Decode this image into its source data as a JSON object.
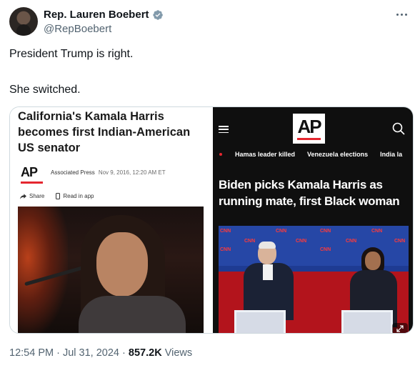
{
  "author": {
    "display_name": "Rep. Lauren Boebert",
    "handle": "@RepBoebert",
    "verified_color": "#829aab"
  },
  "tweet": {
    "line1": "President Trump is right.",
    "line2": "She switched."
  },
  "left_article": {
    "headline": "California's Kamala Harris becomes first Indian-American US senator",
    "logo": "AP",
    "source": "Associated Press",
    "date": "Nov 9, 2016, 12:20 AM ET",
    "share_label": "Share",
    "read_label": "Read in app",
    "accent": "#e5262f"
  },
  "right_article": {
    "logo": "AP",
    "nav_items": [
      "Hamas leader killed",
      "Venezuela elections",
      "India la"
    ],
    "headline": "Biden picks Kamala Harris as running mate, first Black woman",
    "stage_marks": [
      "CNN",
      "CNN",
      "CNN",
      "CNN",
      "CNN",
      "CNN",
      "CNN",
      "CNN",
      "CNN",
      "CNN"
    ],
    "background": "#0f0f0f"
  },
  "meta": {
    "time": "12:54 PM",
    "separator": "·",
    "date": "Jul 31, 2024",
    "views_count": "857.2K",
    "views_label": "Views"
  }
}
